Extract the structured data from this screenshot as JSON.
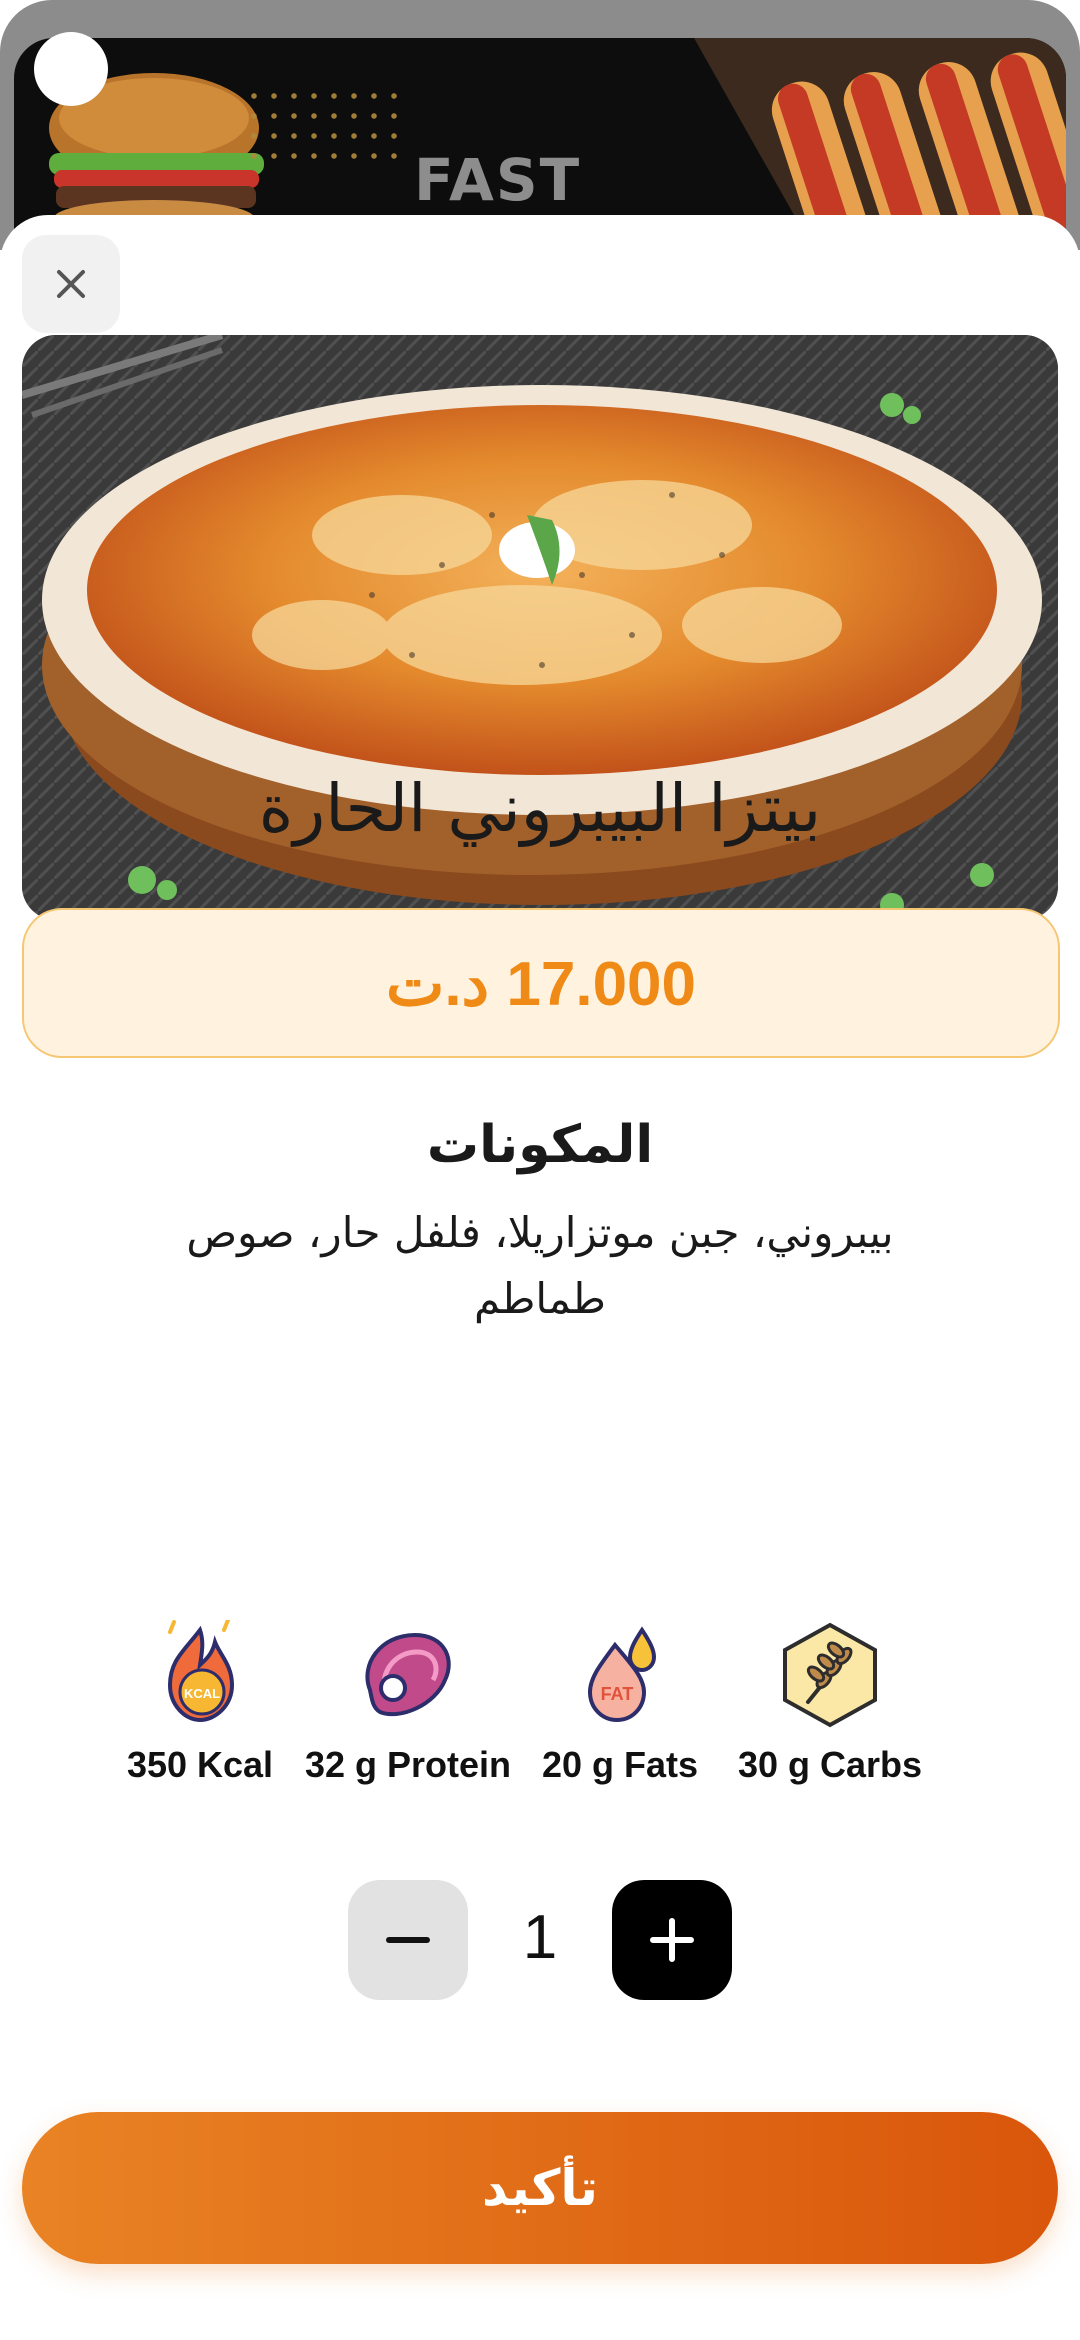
{
  "banner": {
    "word": "FAST"
  },
  "product": {
    "name": "بيتزا البيبروني الحارة",
    "price": "17.000 د.ت"
  },
  "ingredients": {
    "title": "المكونات",
    "text": "بيبروني، جبن موتزاريلا، فلفل حار، صوص طماطم"
  },
  "nutrition": [
    {
      "icon": "kcal-flame-icon",
      "label": "350 Kcal"
    },
    {
      "icon": "protein-steak-icon",
      "label": "32 g Protein"
    },
    {
      "icon": "fat-drop-icon",
      "label": "20 g Fats"
    },
    {
      "icon": "carbs-wheat-icon",
      "label": "30 g Carbs"
    }
  ],
  "quantity": {
    "value": "1"
  },
  "actions": {
    "confirm": "تأكيد"
  },
  "colors": {
    "accent": "#ef8a17",
    "price_bg": "#fff2df",
    "price_border": "#f6c772",
    "confirm_start": "#e98324",
    "confirm_end": "#d9560b"
  }
}
